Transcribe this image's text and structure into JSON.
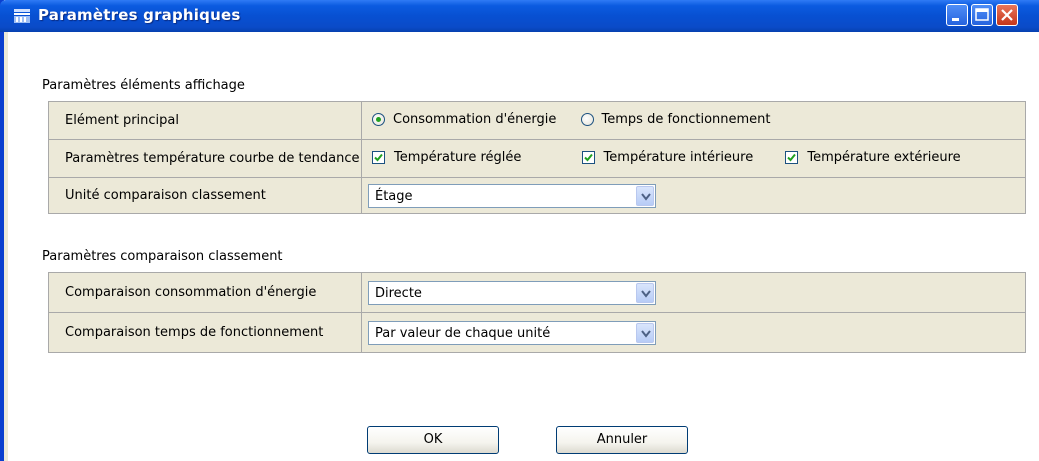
{
  "window": {
    "title": "Paramètres graphiques"
  },
  "display_group": {
    "title": "Paramètres éléments affichage",
    "rows": [
      {
        "label": "Elément principal",
        "options": [
          "Consommation d'énergie",
          "Temps de fonctionnement"
        ],
        "selected": "Consommation d'énergie"
      },
      {
        "label": "Paramètres température courbe de tendance",
        "checkboxes": [
          {
            "label": "Température réglée",
            "checked": true
          },
          {
            "label": "Température intérieure",
            "checked": true
          },
          {
            "label": "Température extérieure",
            "checked": true
          }
        ]
      },
      {
        "label": "Unité comparaison classement",
        "value": "Étage"
      }
    ]
  },
  "ranking_group": {
    "title": "Paramètres comparaison classement",
    "rows": [
      {
        "label": "Comparaison consommation d'énergie",
        "value": "Directe"
      },
      {
        "label": "Comparaison temps de fonctionnement",
        "value": "Par valeur de chaque unité"
      }
    ]
  },
  "buttons": {
    "ok": "OK",
    "cancel": "Annuler"
  },
  "colors": {
    "titlebar": "#0850d2",
    "panel": "#ece9d8",
    "check_mark": "#21a121"
  }
}
